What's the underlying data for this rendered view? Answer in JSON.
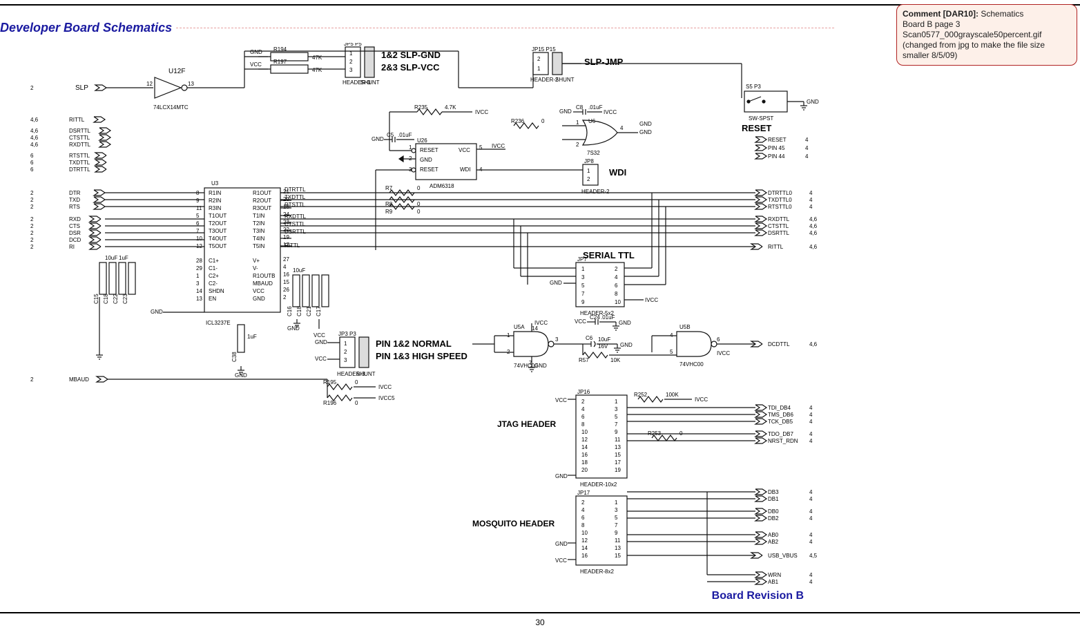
{
  "header": {
    "section_title": "Developer Board Schematics"
  },
  "comment": {
    "label": "Comment [DAR10]:",
    "line1": "Schematics",
    "line2": "Board B page 3",
    "line3": "Scan0577_000grayscale50percent.gif",
    "line4": "(changed from jpg to make the file size smaller 8/5/09)"
  },
  "footer": {
    "board_revision": "Board Revision B",
    "page_number": "30"
  },
  "schematic": {
    "left_ports": {
      "slp": {
        "num": "2",
        "name": "SLP"
      },
      "rittl": {
        "num": "4,6",
        "name": "RITTL"
      },
      "dsrttl": {
        "num": "4,6",
        "name": "DSRTTL"
      },
      "ctsttl": {
        "num": "4,6",
        "name": "CTSTTL"
      },
      "rxdttl": {
        "num": "4,6",
        "name": "RXDTTL"
      },
      "rtsttl": {
        "num": "6",
        "name": "RTSTTL"
      },
      "txdttl": {
        "num": "6",
        "name": "TXDTTL"
      },
      "dtrttl": {
        "num": "6",
        "name": "DTRTTL"
      },
      "dtr": {
        "num": "2",
        "name": "DTR"
      },
      "txd": {
        "num": "2",
        "name": "TXD"
      },
      "rts": {
        "num": "2",
        "name": "RTS"
      },
      "rxd": {
        "num": "2",
        "name": "RXD"
      },
      "cts": {
        "num": "2",
        "name": "CTS"
      },
      "dsr": {
        "num": "2",
        "name": "DSR"
      },
      "dcd": {
        "num": "2",
        "name": "DCD"
      },
      "ri": {
        "num": "2",
        "name": "RI"
      },
      "mbaud": {
        "num": "2",
        "name": "MBAUD"
      }
    },
    "right_ports": {
      "reset": {
        "num": "4",
        "name": "RESET"
      },
      "pin45": {
        "num": "4",
        "name": "PIN 45"
      },
      "pin44": {
        "num": "4",
        "name": "PIN 44"
      },
      "dtrttl0": {
        "num": "4",
        "name": "DTRTTL0"
      },
      "txdttl0": {
        "num": "4",
        "name": "TXDTTL0"
      },
      "rtsttl0": {
        "num": "4",
        "name": "RTSTTL0"
      },
      "rxdttl": {
        "num": "4,6",
        "name": "RXDTTL"
      },
      "ctsttl": {
        "num": "4,6",
        "name": "CTSTTL"
      },
      "dsrttl": {
        "num": "4,6",
        "name": "DSRTTL"
      },
      "rittl": {
        "num": "4,6",
        "name": "RITTL"
      },
      "dcdttl": {
        "num": "4,6",
        "name": "DCDTTL"
      },
      "tdi": {
        "num": "4",
        "name": "TDI_DB4"
      },
      "tms": {
        "num": "4",
        "name": "TMS_DB6"
      },
      "tck": {
        "num": "4",
        "name": "TCK_DB5"
      },
      "tdo": {
        "num": "4",
        "name": "TDO_DB7"
      },
      "nrst": {
        "num": "4",
        "name": "NRST_RDN"
      },
      "db3": {
        "num": "4",
        "name": "DB3"
      },
      "db1": {
        "num": "4",
        "name": "DB1"
      },
      "db0": {
        "num": "4",
        "name": "DB0"
      },
      "db2": {
        "num": "4",
        "name": "DB2"
      },
      "ab0": {
        "num": "4",
        "name": "AB0"
      },
      "ab2": {
        "num": "4",
        "name": "AB2"
      },
      "usb": {
        "num": "4,5",
        "name": "USB_VBUS"
      },
      "wrn": {
        "num": "4",
        "name": "WRN"
      },
      "ab1": {
        "num": "4",
        "name": "AB1"
      }
    },
    "labels": {
      "u12f": "U12F",
      "u12f_part": "74LCX14MTC",
      "u3": "U3",
      "u3_part": "ICL3237E",
      "u26": "U26",
      "u26_part": "ADM6318",
      "u5a": "U5A",
      "u5b": "U5B",
      "u5_part": "74VHC00",
      "u6": "U6",
      "u6_part": "7S32",
      "jp5_p5": "JP5  P5",
      "hdr3": "HEADER-3",
      "shunt": "SHUNT",
      "jp15_p15": "JP15   P15",
      "hdr2": "HEADER-2",
      "jp8": "JP8",
      "wdi": "WDI",
      "jp7": "JP7",
      "serial_ttl": "SERIAL TTL",
      "hdr5x2": "HEADER-5x2",
      "jp3_p3": "JP3  P3",
      "slp12": "1&2 SLP-GND",
      "slp23": "2&3 SLP-VCC",
      "slp_jmp": "SLP-JMP",
      "pin12": "PIN 1&2 NORMAL",
      "pin13": "PIN 1&3  HIGH SPEED",
      "jtag": "JTAG HEADER",
      "jp16": "JP16",
      "hdr10x2": "HEADER-10x2",
      "mosq": "MOSQUITO HEADER",
      "jp17": "JP17",
      "hdr8x2": "HEADER-8x2",
      "reset_blk": "RESET",
      "sw": "SW-SPST",
      "s5_p3": "S5    P3"
    },
    "u3_pins_left": [
      {
        "n": "8",
        "a": "R1IN",
        "b": "R1OUT",
        "m": "21",
        "sig": "DTRTTL"
      },
      {
        "n": "9",
        "a": "R2IN",
        "b": "R2OUT",
        "m": "20",
        "sig": "TXDTTL"
      },
      {
        "n": "11",
        "a": "R3IN",
        "b": "R3OUT",
        "m": "18",
        "sig": "RTSTTL"
      },
      {
        "n": "5",
        "a": "T1OUT",
        "b": "T1IN",
        "m": "24",
        "sig": "RXDTTL"
      },
      {
        "n": "6",
        "a": "T2OUT",
        "b": "T2IN",
        "m": "23",
        "sig": "CTSTTL"
      },
      {
        "n": "7",
        "a": "T3OUT",
        "b": "T3IN",
        "m": "22",
        "sig": "DSRTTL"
      },
      {
        "n": "10",
        "a": "T4OUT",
        "b": "T4IN",
        "m": "19",
        "sig": ""
      },
      {
        "n": "12",
        "a": "T5OUT",
        "b": "T5IN",
        "m": "17",
        "sig": "RITTL"
      }
    ],
    "u3_pins_ctrl": [
      {
        "n": "28",
        "a": "C1+",
        "b": "V+",
        "m": "27"
      },
      {
        "n": "29",
        "a": "C1-",
        "b": "V-",
        "m": "4"
      },
      {
        "n": "1",
        "a": "C2+",
        "b": "R1OUTB",
        "m": "16"
      },
      {
        "n": "3",
        "a": "C2-",
        "b": "MBAUD",
        "m": "15"
      },
      {
        "n": "14",
        "a": "SHDN",
        "b": "VCC",
        "m": "26"
      },
      {
        "n": "13",
        "a": "EN",
        "b": "GND",
        "m": "2"
      }
    ],
    "u26_pins": {
      "l1": "RESET",
      "l2": "GND",
      "l3": "RESET",
      "r1": "VCC",
      "r3": "WDI"
    },
    "caps_left": [
      "C15",
      "C18",
      "C22",
      "C23",
      "C38"
    ],
    "caps_mid": [
      "C16",
      "C18",
      "C21",
      "C17"
    ],
    "caps_vals": {
      "c10uf": "10uF",
      "c1uf": "1uF",
      "c01uf": ".01uF"
    },
    "resistors": {
      "r194": {
        "ref": "R194",
        "val": "47K"
      },
      "r197": {
        "ref": "R197",
        "val": "47K"
      },
      "r235": {
        "ref": "R235",
        "val": "4.7K"
      },
      "r236": {
        "ref": "R236",
        "val": "0"
      },
      "r7": {
        "ref": "R7",
        "val": "0"
      },
      "r8": {
        "ref": "R8",
        "val": "0"
      },
      "r9": {
        "ref": "R9",
        "val": "0"
      },
      "r195": {
        "ref": "R195",
        "val": "0"
      },
      "r196": {
        "ref": "R196",
        "val": "0"
      },
      "r57": {
        "ref": "R57",
        "val": "10K"
      },
      "r252": {
        "ref": "R252",
        "val": "100K"
      },
      "r253": {
        "ref": "R253",
        "val": "0"
      }
    },
    "caps_named": {
      "c5": {
        "ref": "C5",
        "val": ".01uF"
      },
      "c8": {
        "ref": "C8",
        "val": ".01uF"
      },
      "c24": {
        "ref": "C24",
        "val": ".01uF"
      },
      "c6": {
        "ref": "C6",
        "val": "10uF",
        "volt": "16V"
      }
    },
    "power": {
      "vcc": "VCC",
      "gnd": "GND",
      "ivcc": "IVCC",
      "ivcc5": "IVCC5"
    },
    "hdr_nums_5x2": [
      "1",
      "2",
      "3",
      "4",
      "5",
      "6",
      "7",
      "8",
      "9",
      "10"
    ],
    "hdr_nums_10x2": [
      "2",
      "1",
      "4",
      "3",
      "6",
      "5",
      "8",
      "7",
      "10",
      "9",
      "12",
      "11",
      "14",
      "13",
      "16",
      "15",
      "18",
      "17",
      "20",
      "19"
    ],
    "hdr_nums_8x2": [
      "2",
      "1",
      "4",
      "3",
      "6",
      "5",
      "8",
      "7",
      "10",
      "9",
      "12",
      "11",
      "14",
      "13",
      "16",
      "15"
    ],
    "misc_nums": {
      "u12f_in": "12",
      "u12f_out": "13",
      "u26_p1": "1",
      "u26_p2": "2",
      "u26_p3": "3",
      "u26_p4": "4",
      "u26_p5": "5",
      "u5a_1": "1",
      "u5a_2": "2",
      "u5a_14": "14",
      "u5b_4": "4",
      "u5b_5": "5",
      "u5b_6": "6",
      "u5a_7": "7",
      "u5a_3": "3",
      "u6_1": "1",
      "u6_2": "2",
      "u6_4": "4"
    }
  }
}
